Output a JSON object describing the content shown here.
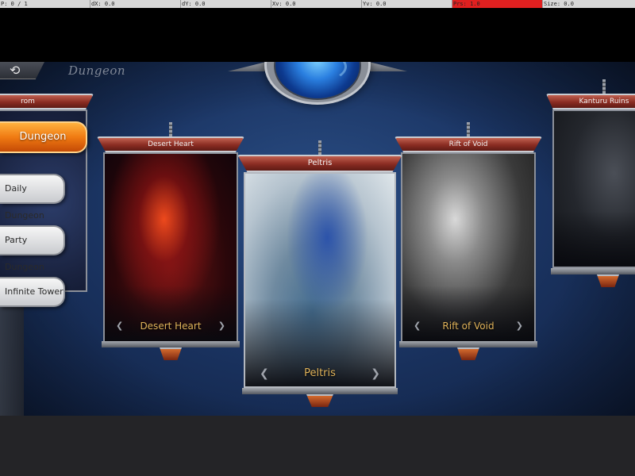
{
  "debug_bar": [
    {
      "text": "P: 0 / 1",
      "hot": false
    },
    {
      "text": "dX: 0.0",
      "hot": false
    },
    {
      "text": "dY: 0.0",
      "hot": false
    },
    {
      "text": "Xv: 0.0",
      "hot": false
    },
    {
      "text": "Yv: 0.0",
      "hot": false
    },
    {
      "text": "Prs: 1.0",
      "hot": true
    },
    {
      "text": "Size: 0.0",
      "hot": false
    }
  ],
  "header": {
    "back_icon": "back-arrow-icon",
    "back_glyph": "⟲",
    "title": "Dungeon"
  },
  "side_menu": {
    "items": [
      {
        "label": "Dungeon",
        "active": true
      },
      {
        "label": "Daily Dungeon",
        "active": false
      },
      {
        "label": "Party Dungeon",
        "active": false
      },
      {
        "label": "Infinite Tower",
        "active": false
      }
    ]
  },
  "cards": {
    "left_partial": {
      "banner": "rom"
    },
    "desert_heart": {
      "banner": "Desert Heart",
      "name": "Desert Heart"
    },
    "peltris": {
      "banner": "Peltris",
      "name": "Peltris",
      "selected": true
    },
    "rift_of_void": {
      "banner": "Rift of Void",
      "name": "Rift of Void"
    },
    "kanturu_ruins": {
      "banner": "Kanturu Ruins"
    }
  },
  "ornaments": {
    "left_glyph": "❮",
    "right_glyph": "❯"
  },
  "colors": {
    "accent_orange": "#f07a12",
    "banner_red": "#8a2c22",
    "card_name_gold": "#e0b35a",
    "debug_hot": "#e02020"
  }
}
